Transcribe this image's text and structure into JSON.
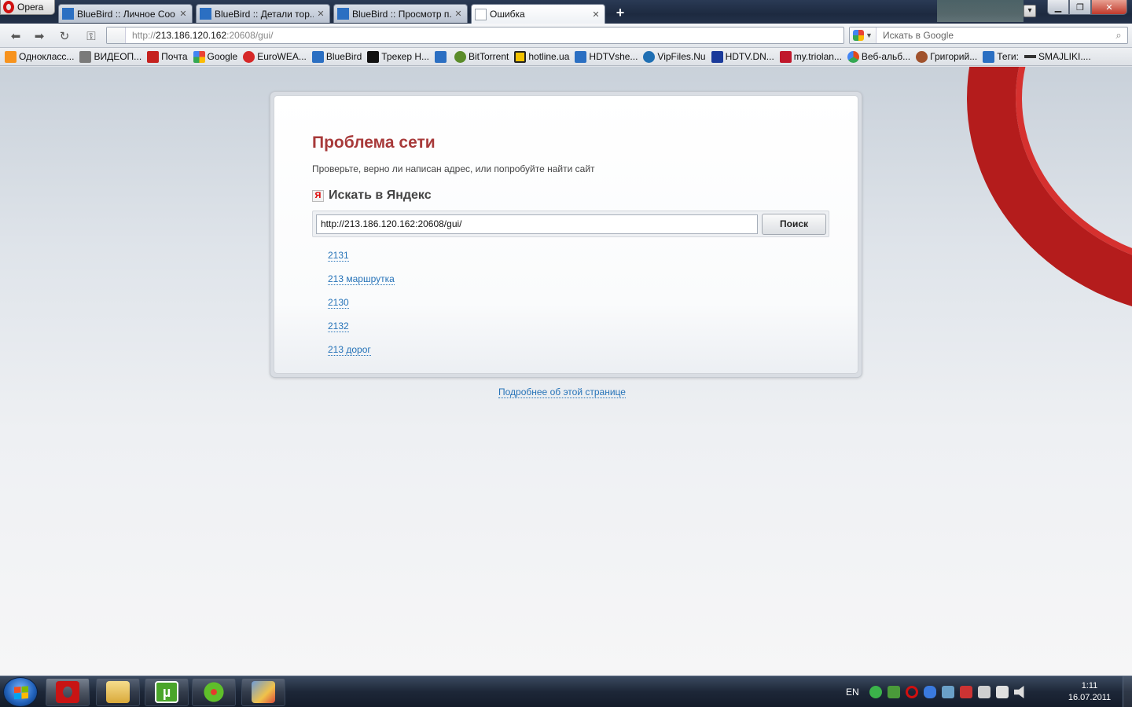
{
  "opera_menu": {
    "label": "Opera"
  },
  "tabs": [
    {
      "title": "BlueBird :: Личное Соо...",
      "close": "✕",
      "icon_color": "#2b6fc2"
    },
    {
      "title": "BlueBird :: Детали тор...",
      "close": "✕",
      "icon_color": "#2b6fc2"
    },
    {
      "title": "BlueBird :: Просмотр п...",
      "close": "✕",
      "icon_color": "#2b6fc2"
    },
    {
      "title": "Ошибка",
      "close": "✕",
      "icon_color": "#9aa2ad"
    }
  ],
  "newtab": {
    "label": "+"
  },
  "address": {
    "host": "http://",
    "domain": "213.186.120.162",
    "rest": ":20608/gui/"
  },
  "search": {
    "placeholder": "Искать в Google"
  },
  "bookmarks": [
    {
      "label": "Однокласс...",
      "color": "#f7931e"
    },
    {
      "label": "ВИДЕОП...",
      "color": "#7a7a7a"
    },
    {
      "label": "Почта",
      "color": "#c5221f"
    },
    {
      "label": "Google",
      "color": "#4285f4"
    },
    {
      "label": "EuroWEA...",
      "color": "#d62828"
    },
    {
      "label": "BlueBird",
      "color": "#2b6fc2"
    },
    {
      "label": "Трекер Н...",
      "color": "#111111"
    },
    {
      "label": "",
      "color": "#2b6fc2"
    },
    {
      "label": "BitTorrent",
      "color": "#5b8c2a"
    },
    {
      "label": "hotline.ua",
      "color": "#222222"
    },
    {
      "label": "HDTVshe...",
      "color": "#2b6fc2"
    },
    {
      "label": "VipFiles.Nu",
      "color": "#1f6fb3"
    },
    {
      "label": "HDTV.DN...",
      "color": "#1a3a9a"
    },
    {
      "label": "my.triolan...",
      "color": "#c0182c"
    },
    {
      "label": "Веб-альб...",
      "color": "#e24a1b"
    },
    {
      "label": "Григорий...",
      "color": "#a0522d"
    },
    {
      "label": "Теги:",
      "color": "#2b6fc2"
    },
    {
      "label": "SMAJLIKI....",
      "color": "#333333"
    }
  ],
  "error": {
    "title": "Проблема сети",
    "description": "Проверьте, верно ли написан адрес, или попробуйте найти сайт",
    "yandex_heading": "Искать в Яндекс",
    "yandex_icon": "Я",
    "query": "http://213.186.120.162:20608/gui/",
    "search_button": "Поиск",
    "suggestions": [
      "2131",
      "213 маршрутка",
      "2130",
      "2132",
      "213 дорог"
    ],
    "more_link": "Подробнее об этой странице"
  },
  "taskbar": {
    "lang": "EN",
    "time": "1:11",
    "date": "16.07.2011",
    "apps": [
      {
        "name": "opera",
        "color": "#c81414",
        "active": true
      },
      {
        "name": "explorer",
        "color": "#e8c46a",
        "active": false
      },
      {
        "name": "utorrent",
        "color": "#4aa52a",
        "active": false
      },
      {
        "name": "icq",
        "color": "#5fbf2a",
        "active": false
      },
      {
        "name": "paint",
        "color": "#6d9bd8",
        "active": false
      }
    ],
    "tray_icons": [
      "#3bb34a",
      "#4a9a3a",
      "#d01010",
      "#3a7adf",
      "#6aa0c8",
      "#cc3333",
      "#cfcfcf",
      "#e0e0e0",
      "#dcdcdc"
    ]
  }
}
